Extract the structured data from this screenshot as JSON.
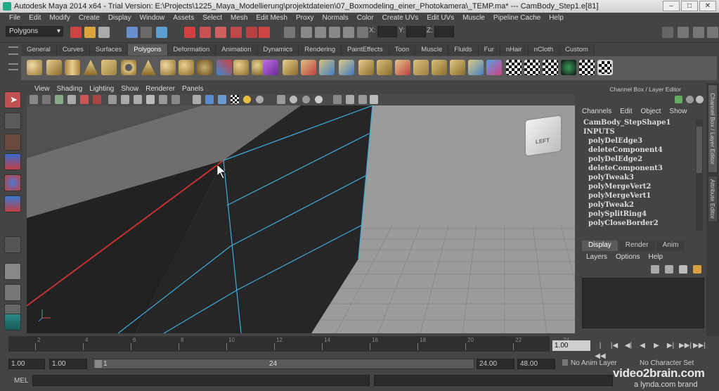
{
  "window": {
    "title": "Autodesk Maya 2014 x64 - Trial Version: E:\\Projects\\1225_Maya_Modellierung\\projektdateien\\07_Boxmodeling_einer_Photokamera\\_TEMP.ma*  ---  CamBody_Step1.e[81]",
    "controls": [
      "–",
      "□",
      "✕"
    ]
  },
  "menubar": [
    "File",
    "Edit",
    "Modify",
    "Create",
    "Display",
    "Window",
    "Assets",
    "Select",
    "Mesh",
    "Edit Mesh",
    "Proxy",
    "Normals",
    "Color",
    "Create UVs",
    "Edit UVs",
    "Muscle",
    "Pipeline Cache",
    "Help"
  ],
  "statusline": {
    "menuset": "Polygons",
    "x_label": "X:",
    "y_label": "Y:",
    "z_label": "Z:"
  },
  "shelf_tabs": [
    "General",
    "Curves",
    "Surfaces",
    "Polygons",
    "Deformation",
    "Animation",
    "Dynamics",
    "Rendering",
    "PaintEffects",
    "Toon",
    "Muscle",
    "Fluids",
    "Fur",
    "nHair",
    "nCloth",
    "Custom"
  ],
  "shelf_active": "Polygons",
  "panel_menu": [
    "View",
    "Shading",
    "Lighting",
    "Show",
    "Renderer",
    "Panels"
  ],
  "viewcube_label": "LEFT",
  "channel_box": {
    "header": "Channel Box / Layer Editor",
    "menu": [
      "Channels",
      "Edit",
      "Object",
      "Show"
    ],
    "shape": "CamBody_StepShape1",
    "inputs_label": "INPUTS",
    "inputs": [
      "polyDelEdge3",
      "deleteComponent4",
      "polyDelEdge2",
      "deleteComponent3",
      "polyTweak3",
      "polyMergeVert2",
      "polyMergeVert1",
      "polyTweak2",
      "polySplitRing4",
      "polyCloseBorder2"
    ]
  },
  "side_tabs": [
    "Channel Box / Layer Editor",
    "Attribute Editor"
  ],
  "layer_editor": {
    "tabs": [
      "Display",
      "Render",
      "Anim"
    ],
    "active_tab": "Display",
    "menu": [
      "Layers",
      "Options",
      "Help"
    ]
  },
  "timeline": {
    "ticks": [
      "2",
      "4",
      "6",
      "8",
      "10",
      "12",
      "14",
      "16",
      "18",
      "20",
      "22",
      "24"
    ],
    "current_frame": "1.00",
    "playback": [
      "|◀◀",
      "|◀",
      "◀|",
      "◀",
      "▶",
      "▶|",
      "▶▶|",
      "▶▶|"
    ]
  },
  "range": {
    "start": "1.00",
    "playback_start": "1.00",
    "slider_start": "1",
    "slider_end": "24",
    "playback_end": "24.00",
    "end": "48.00",
    "anim_layer": "No Anim Layer",
    "character_set": "No Character Set"
  },
  "command_line": {
    "label": "MEL"
  },
  "watermark": {
    "brand": "video2brain.com",
    "sub": "a lynda.com brand"
  }
}
